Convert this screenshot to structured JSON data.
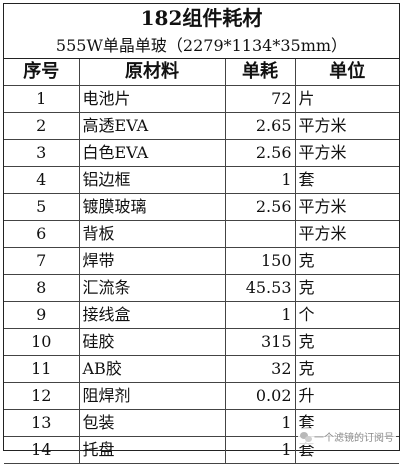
{
  "title": "182组件耗材",
  "subtitle": "555W单晶单玻（2279*1134*35mm）",
  "headers": {
    "seq": "序号",
    "material": "原材料",
    "usage": "单耗",
    "unit": "单位"
  },
  "rows": [
    {
      "seq": "1",
      "material": "电池片",
      "usage": "72",
      "unit": "片"
    },
    {
      "seq": "2",
      "material": "高透EVA",
      "usage": "2.65",
      "unit": "平方米"
    },
    {
      "seq": "3",
      "material": "白色EVA",
      "usage": "2.56",
      "unit": "平方米"
    },
    {
      "seq": "4",
      "material": "铝边框",
      "usage": "1",
      "unit": "套"
    },
    {
      "seq": "5",
      "material": "镀膜玻璃",
      "usage": "2.56",
      "unit": "平方米"
    },
    {
      "seq": "6",
      "material": "背板",
      "usage": "",
      "unit": "平方米"
    },
    {
      "seq": "7",
      "material": "焊带",
      "usage": "150",
      "unit": "克"
    },
    {
      "seq": "8",
      "material": "汇流条",
      "usage": "45.53",
      "unit": "克"
    },
    {
      "seq": "9",
      "material": "接线盒",
      "usage": "1",
      "unit": "个"
    },
    {
      "seq": "10",
      "material": "硅胶",
      "usage": "315",
      "unit": "克"
    },
    {
      "seq": "11",
      "material": "AB胶",
      "usage": "32",
      "unit": "克"
    },
    {
      "seq": "12",
      "material": "阻焊剂",
      "usage": "0.02",
      "unit": "升"
    },
    {
      "seq": "13",
      "material": "包装",
      "usage": "1",
      "unit": "套"
    },
    {
      "seq": "14",
      "material": "托盘",
      "usage": "1",
      "unit": "套"
    }
  ],
  "watermark": {
    "text": "一个滤镜的订阅号",
    "icon": "wechat-icon"
  }
}
